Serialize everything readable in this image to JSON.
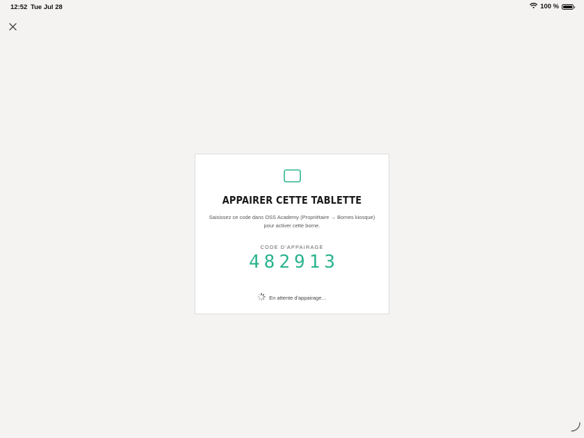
{
  "status_bar": {
    "time": "12:52",
    "date": "Tue Jul 28",
    "battery_text": "100 %"
  },
  "icons": {
    "close": "close-icon",
    "tablet": "tablet-icon",
    "wifi": "wifi-icon",
    "battery": "battery-icon",
    "spinner": "spinner-icon"
  },
  "card": {
    "title": "APPAIRER CETTE TABLETTE",
    "description": "Saisissez ce code dans OSS Academy (Propriétaire → Bornes kiosque) pour activer cette borne.",
    "code_label": "CODE D'APPAIRAGE",
    "code": "482913",
    "waiting_text": "En attente d'appairage…"
  },
  "colors": {
    "accent": "#2ab38e",
    "background": "#f4f3f1",
    "card": "#ffffff"
  }
}
